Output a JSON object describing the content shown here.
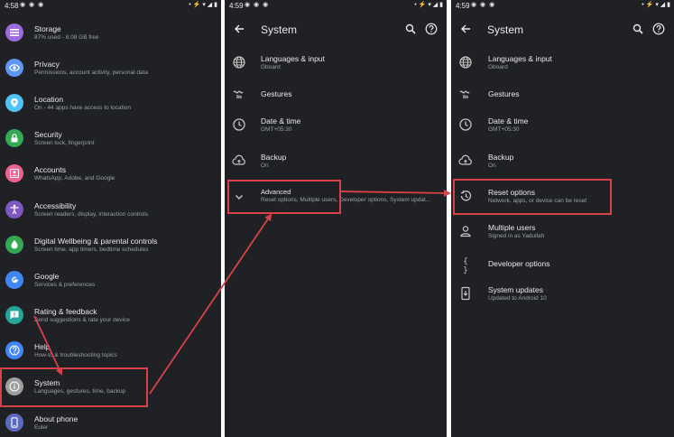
{
  "panels": [
    {
      "status": {
        "time": "4:58",
        "apps": "◉ ◉ ◉",
        "sys": "• ⚡ ▾ ◢ ▮"
      },
      "items": [
        {
          "title": "Storage",
          "subtitle": "87% used - 8.08 GB free",
          "color": "#9c6ade",
          "icon": "storage-icon"
        },
        {
          "title": "Privacy",
          "subtitle": "Permissions, account activity, personal data",
          "color": "#5e97f6",
          "icon": "privacy-eye-icon"
        },
        {
          "title": "Location",
          "subtitle": "On - 44 apps have access to location",
          "color": "#4fc3f7",
          "icon": "location-pin-icon"
        },
        {
          "title": "Security",
          "subtitle": "Screen lock, fingerprint",
          "color": "#34a853",
          "icon": "lock-icon"
        },
        {
          "title": "Accounts",
          "subtitle": "WhatsApp, Adobe, and Google",
          "color": "#f06292",
          "icon": "accounts-icon"
        },
        {
          "title": "Accessibility",
          "subtitle": "Screen readers, display, interaction controls",
          "color": "#7e57c2",
          "icon": "accessibility-icon"
        },
        {
          "title": "Digital Wellbeing & parental controls",
          "subtitle": "Screen time, app timers, bedtime schedules",
          "color": "#34a853",
          "icon": "wellbeing-icon"
        },
        {
          "title": "Google",
          "subtitle": "Services & preferences",
          "color": "#4285f4",
          "icon": "google-icon"
        },
        {
          "title": "Rating & feedback",
          "subtitle": "Send suggestions & rate your device",
          "color": "#26a69a",
          "icon": "feedback-icon"
        },
        {
          "title": "Help",
          "subtitle": "How-to & troubleshooting topics",
          "color": "#4285f4",
          "icon": "help-icon"
        },
        {
          "title": "System",
          "subtitle": "Languages, gestures, time, backup",
          "color": "#9e9e9e",
          "icon": "system-info-icon"
        },
        {
          "title": "About phone",
          "subtitle": "Euler",
          "color": "#5c6bc0",
          "icon": "phone-icon"
        }
      ]
    },
    {
      "status": {
        "time": "4:59",
        "apps": "◉ ◉ ◉",
        "sys": "• ⚡ ▾ ◢ ▮"
      },
      "header": "System",
      "items": [
        {
          "title": "Languages & input",
          "subtitle": "Gboard",
          "icon": "globe-icon"
        },
        {
          "title": "Gestures",
          "subtitle": "",
          "icon": "gestures-icon"
        },
        {
          "title": "Date & time",
          "subtitle": "GMT+05:30",
          "icon": "clock-icon"
        },
        {
          "title": "Backup",
          "subtitle": "On",
          "icon": "cloud-upload-icon"
        },
        {
          "title": "Advanced",
          "subtitle": "Reset options, Multiple users, Developer options, System updat...",
          "icon": "chevron-down-icon"
        }
      ]
    },
    {
      "status": {
        "time": "4:59",
        "apps": "◉ ◉ ◉",
        "sys": "• ⚡ ▾ ◢ ▮"
      },
      "header": "System",
      "items": [
        {
          "title": "Languages & input",
          "subtitle": "Gboard",
          "icon": "globe-icon"
        },
        {
          "title": "Gestures",
          "subtitle": "",
          "icon": "gestures-icon"
        },
        {
          "title": "Date & time",
          "subtitle": "GMT+05:30",
          "icon": "clock-icon"
        },
        {
          "title": "Backup",
          "subtitle": "On",
          "icon": "cloud-upload-icon"
        },
        {
          "title": "Reset options",
          "subtitle": "Network, apps, or device can be reset",
          "icon": "history-icon"
        },
        {
          "title": "Multiple users",
          "subtitle": "Signed in as Yadullah",
          "icon": "person-icon"
        },
        {
          "title": "Developer options",
          "subtitle": "",
          "icon": "code-braces-icon"
        },
        {
          "title": "System updates",
          "subtitle": "Updated to Android 10",
          "icon": "system-update-icon"
        }
      ]
    }
  ],
  "accent": "#d9414a"
}
